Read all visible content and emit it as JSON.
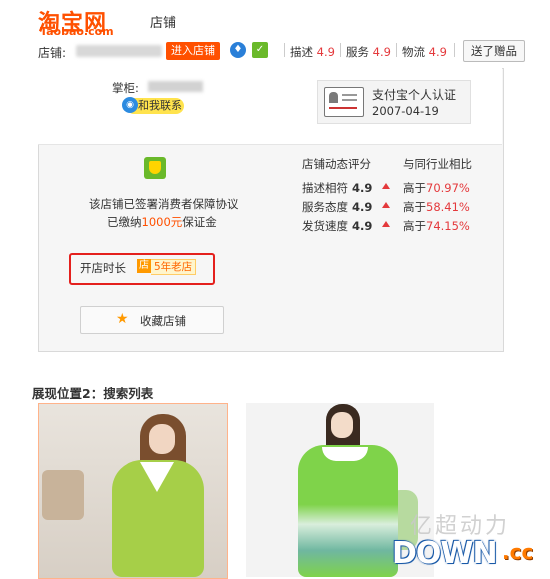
{
  "header": {
    "logo_cn": "淘宝网",
    "logo_en": "Taobao.com",
    "title": "店铺"
  },
  "topbar": {
    "shop_label": "店铺:",
    "enter_button": "进入店铺",
    "metrics": [
      {
        "label": "描述",
        "score": "4.9"
      },
      {
        "label": "服务",
        "score": "4.9"
      },
      {
        "label": "物流",
        "score": "4.9"
      }
    ],
    "gift_button": "送了赠品"
  },
  "panel": {
    "keeper_label": "掌柜:",
    "contact_button": "和我联系",
    "alipay_text": "支付宝个人认证",
    "alipay_date": "2007-04-19",
    "guarantee_line1": "该店铺已签署消费者保障协议",
    "guarantee_line2_prefix": "已缴纳",
    "guarantee_amount": "1000元",
    "guarantee_line2_suffix": "保证金",
    "dynamic_header": "店铺动态评分",
    "compare_header": "与同行业相比",
    "ratings": [
      {
        "label": "描述相符",
        "score": "4.9",
        "compare": "高于",
        "pct": "70.97%"
      },
      {
        "label": "服务态度",
        "score": "4.9",
        "compare": "高于",
        "pct": "58.41%"
      },
      {
        "label": "发货速度",
        "score": "4.9",
        "compare": "高于",
        "pct": "74.15%"
      }
    ],
    "open_label": "开店时长",
    "shop_tag": "店",
    "years_tag": "5年老店",
    "favorite_button": "收藏店铺"
  },
  "section": {
    "title": "展现位置2：搜索列表"
  },
  "watermark": {
    "cn": "亿超动力",
    "down": "DOWN",
    "cc": ".cc"
  },
  "colors": {
    "brand": "#ff5000",
    "score_red": "#e4393c",
    "frame_red": "#e4201d"
  }
}
